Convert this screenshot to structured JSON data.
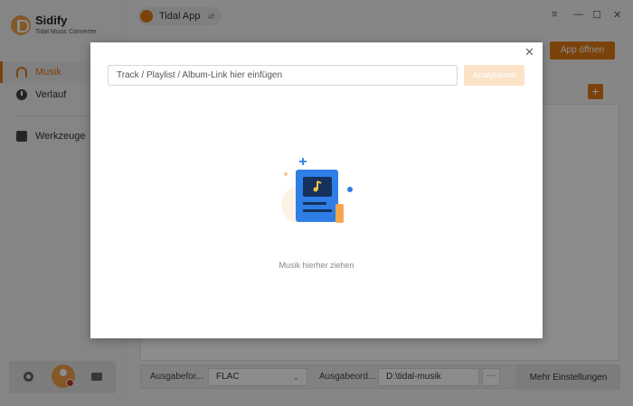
{
  "app": {
    "brand": "Sidify",
    "brand_sub": "Tidal Music Converter"
  },
  "sidebar": {
    "items": [
      {
        "label": "Musik",
        "icon": "headphones-icon",
        "active": true
      },
      {
        "label": "Verlauf",
        "icon": "clock-icon",
        "active": false
      },
      {
        "label": "Werkzeuge",
        "icon": "toolbox-icon",
        "active": false
      }
    ]
  },
  "topbar": {
    "source_label": "Tidal App",
    "app_open_label": "App öffnen",
    "window_controls": [
      "≡",
      "—",
      "☐",
      "✕"
    ]
  },
  "bottom_settings": {
    "format_label": "Ausgabefor...",
    "format_value": "FLAC",
    "folder_label": "Ausgabeord...",
    "folder_value": "D:\\tidal-musik",
    "folder_dots": "···",
    "more_label": "Mehr Einstellungen"
  },
  "modal": {
    "close": "✕",
    "input_placeholder": "Track / Playlist / Album-Link hier einfügen",
    "input_value": "",
    "analyze_label": "Analysieren",
    "drop_text": "Musik hierher ziehen"
  },
  "colors": {
    "accent": "#e07b14",
    "accent_light": "#fbe3c8",
    "illustration_blue": "#2f7ee6"
  }
}
